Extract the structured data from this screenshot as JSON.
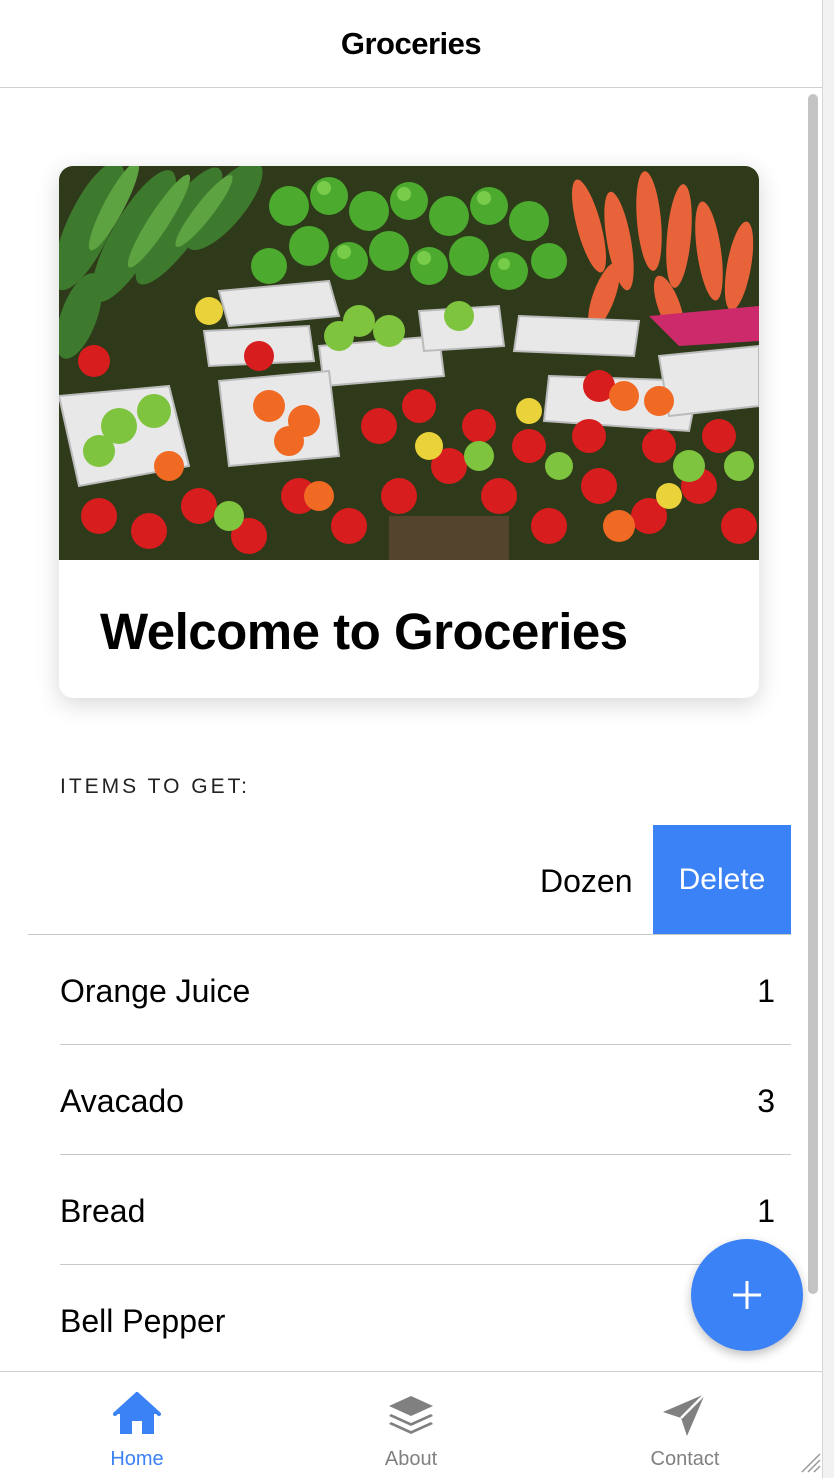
{
  "header": {
    "title": "Groceries"
  },
  "card": {
    "title": "Welcome to Groceries"
  },
  "list": {
    "section_label": "ITEMS TO GET:",
    "swiped_item": {
      "qty": "Dozen",
      "delete_label": "Delete"
    },
    "items": [
      {
        "name": "Orange Juice",
        "qty": "1"
      },
      {
        "name": "Avacado",
        "qty": "3"
      },
      {
        "name": "Bread",
        "qty": "1"
      },
      {
        "name": "Bell Pepper",
        "qty": ""
      }
    ]
  },
  "fab": {
    "icon": "plus-icon"
  },
  "tabs": [
    {
      "label": "Home",
      "icon": "home-icon",
      "active": true
    },
    {
      "label": "About",
      "icon": "layers-icon",
      "active": false
    },
    {
      "label": "Contact",
      "icon": "send-icon",
      "active": false
    }
  ],
  "colors": {
    "accent": "#3b82f6",
    "inactive": "#808080"
  }
}
